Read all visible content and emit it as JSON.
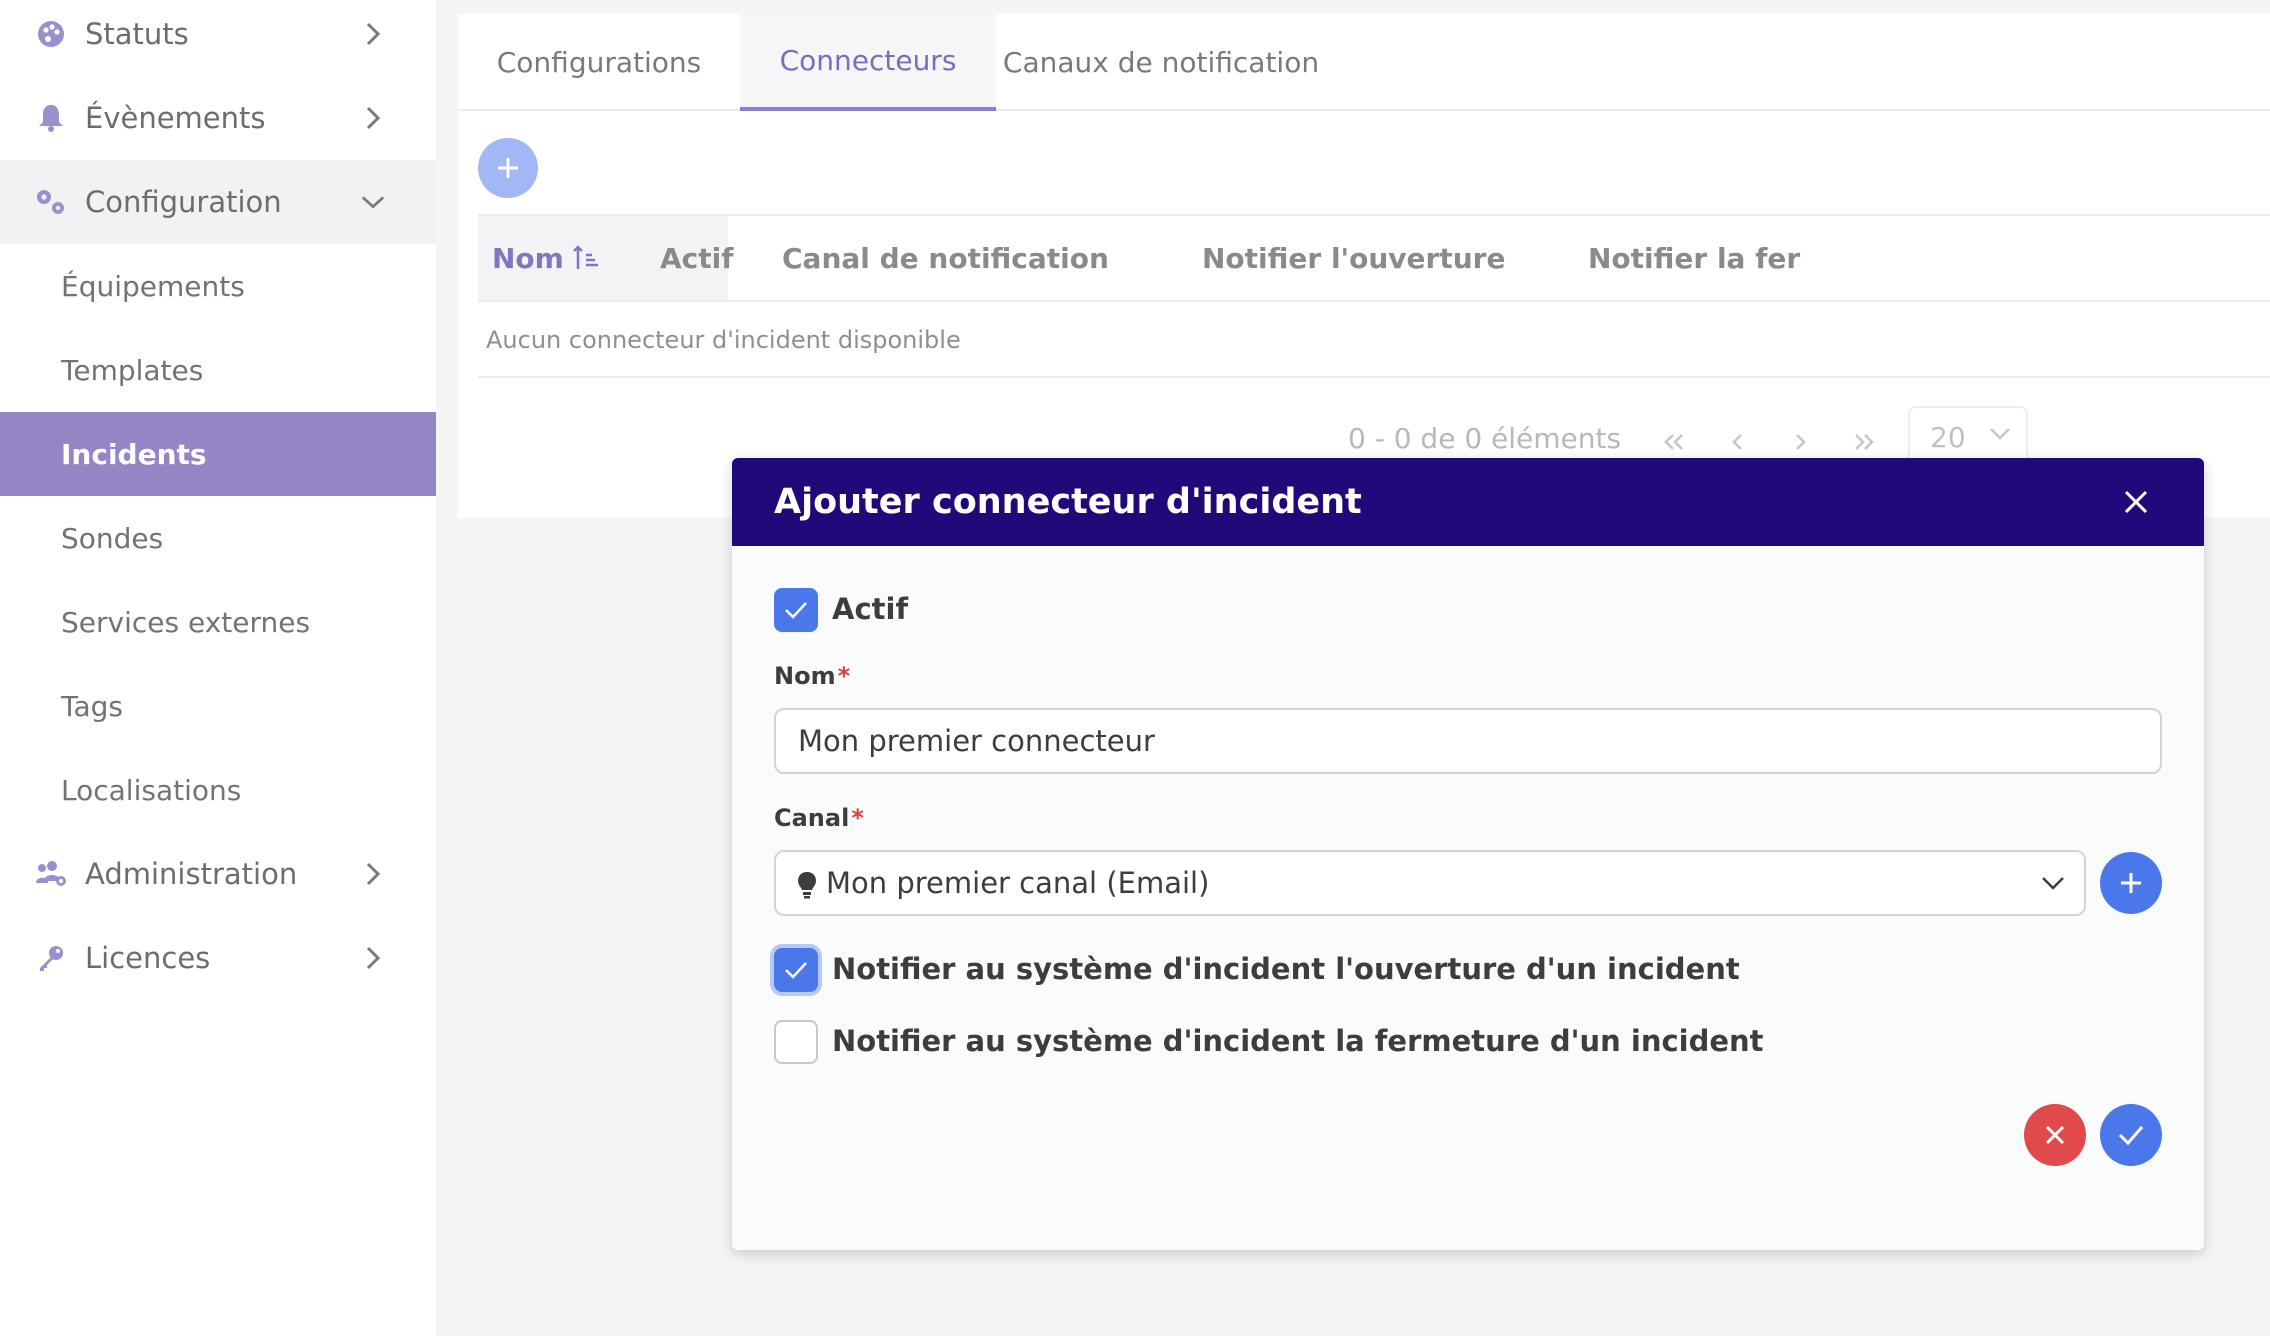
{
  "sidebar": {
    "items": [
      {
        "label": "Statuts",
        "icon": "palette-icon"
      },
      {
        "label": "Évènements",
        "icon": "bell-icon"
      },
      {
        "label": "Configuration",
        "icon": "gears-icon"
      },
      {
        "label": "Administration",
        "icon": "users-cog-icon"
      },
      {
        "label": "Licences",
        "icon": "key-icon"
      }
    ],
    "config_children": [
      "Équipements",
      "Templates",
      "Incidents",
      "Sondes",
      "Services externes",
      "Tags",
      "Localisations"
    ],
    "active_child": "Incidents"
  },
  "tabs": [
    "Configurations",
    "Connecteurs",
    "Canaux de notification"
  ],
  "active_tab": "Connecteurs",
  "table": {
    "columns": [
      "Nom",
      "Actif",
      "Canal de notification",
      "Notifier l'ouverture",
      "Notifier la fer"
    ],
    "empty_message": "Aucun connecteur d'incident disponible"
  },
  "pagination": {
    "info": "0 - 0 de 0 éléments",
    "page_size": "20"
  },
  "modal": {
    "title": "Ajouter connecteur d'incident",
    "actif_label": "Actif",
    "actif_checked": true,
    "name_label": "Nom",
    "name_value": "Mon premier connecteur",
    "channel_label": "Canal",
    "channel_value": "Mon premier canal (Email)",
    "notify_open_label": "Notifier au système d'incident l'ouverture d'un incident",
    "notify_open_checked": true,
    "notify_close_label": "Notifier au système d'incident la fermeture d'un incident",
    "notify_close_checked": false,
    "required_mark": "*"
  },
  "colors": {
    "sidebar_active": "#9585c4",
    "modal_header": "#22097a",
    "primary_blue": "#4a78ea",
    "danger_red": "#e04a4a",
    "tab_active": "#7c6cc0"
  }
}
